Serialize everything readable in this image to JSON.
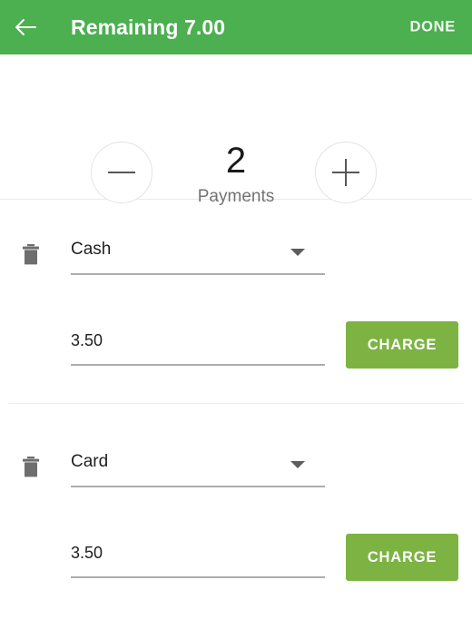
{
  "appbar": {
    "back_icon": "arrow-left-icon",
    "title": "Remaining 7.00",
    "done_label": "DONE",
    "background_color": "#4caf50",
    "title_color": "#ffffff"
  },
  "stepper": {
    "decrement_icon": "minus-icon",
    "increment_icon": "plus-icon",
    "count": "2",
    "count_label": "Payments"
  },
  "payments": [
    {
      "delete_icon": "trash-icon",
      "method": "Cash",
      "method_caret_icon": "caret-down-icon",
      "amount": "3.50",
      "charge_label": "CHARGE"
    },
    {
      "delete_icon": "trash-icon",
      "method": "Card",
      "method_caret_icon": "caret-down-icon",
      "amount": "3.50",
      "charge_label": "CHARGE"
    }
  ],
  "colors": {
    "header_green": "#4caf50",
    "button_green": "#7cb342",
    "underline_gray": "#adadad",
    "divider_gray": "#eaeaea"
  }
}
